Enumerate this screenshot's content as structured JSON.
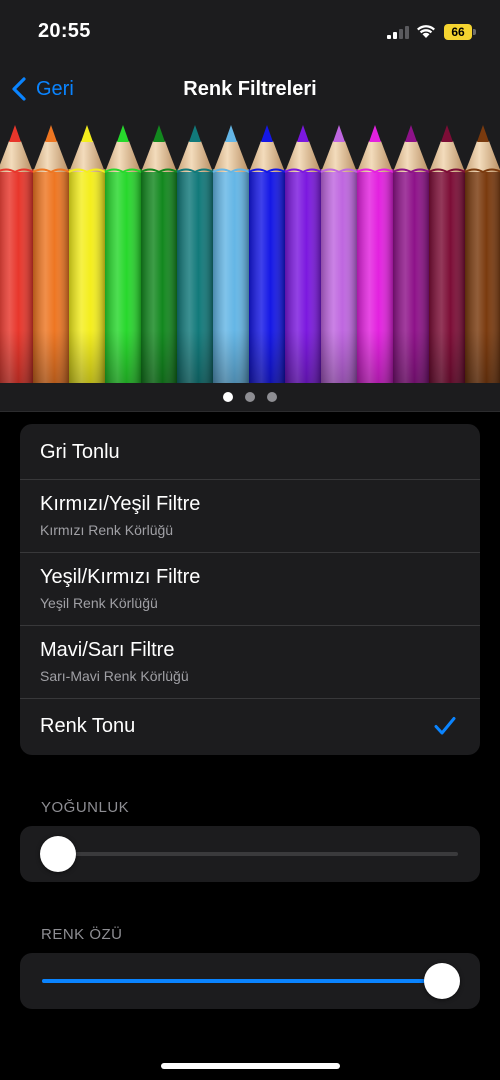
{
  "status_bar": {
    "time": "20:55",
    "battery_level": "66",
    "icons": [
      "cellular-signal-icon",
      "wifi-icon",
      "battery-icon"
    ]
  },
  "nav": {
    "back_label": "Geri",
    "title": "Renk Filtreleri"
  },
  "preview": {
    "description_icon": "colored-pencils-image",
    "pencil_colors": [
      "#e8362b",
      "#ee7622",
      "#f4ee1d",
      "#27d82c",
      "#12881e",
      "#11797a",
      "#64b6e6",
      "#1417e6",
      "#7b18df",
      "#bf66e0",
      "#e321df",
      "#8e1289",
      "#7c0d36",
      "#7a3a0e"
    ],
    "pages": 3,
    "active_page": 0
  },
  "filters": [
    {
      "title": "Gri Tonlu",
      "subtitle": "",
      "selected": false
    },
    {
      "title": "Kırmızı/Yeşil Filtre",
      "subtitle": "Kırmızı Renk Körlüğü",
      "selected": false
    },
    {
      "title": "Yeşil/Kırmızı Filtre",
      "subtitle": "Yeşil Renk Körlüğü",
      "selected": false
    },
    {
      "title": "Mavi/Sarı Filtre",
      "subtitle": "Sarı-Mavi Renk Körlüğü",
      "selected": false
    },
    {
      "title": "Renk Tonu",
      "subtitle": "",
      "selected": true
    }
  ],
  "intensity": {
    "label": "YOĞUNLUK",
    "value": 0.0
  },
  "hue": {
    "label": "RENK ÖZÜ",
    "value": 1.0
  },
  "colors": {
    "accent": "#0a84ff",
    "background": "#000000",
    "card": "#1c1c1e",
    "battery": "#f5d430"
  }
}
